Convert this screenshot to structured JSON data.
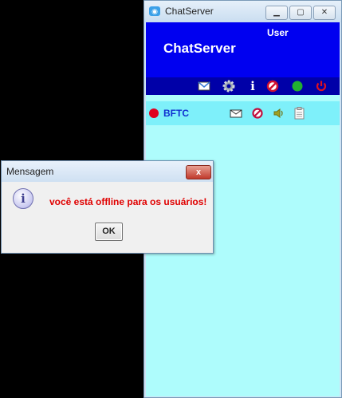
{
  "window": {
    "title": "ChatServer",
    "header": {
      "user_label": "User",
      "app_name": "ChatServer"
    },
    "toolbar": [
      "mail-icon",
      "gear-icon",
      "info-icon",
      "block-icon",
      "online-status-icon",
      "power-icon"
    ]
  },
  "users": [
    {
      "name": "BFTC",
      "status": "offline",
      "status_color": "#e00020",
      "actions": [
        "mail-icon",
        "block-icon",
        "speaker-icon",
        "clipboard-icon"
      ]
    }
  ],
  "dialog": {
    "title": "Mensagem",
    "message": "você está offline para os usuários!",
    "ok_label": "OK",
    "close_label": "x"
  },
  "colors": {
    "header_bg": "#0000f0",
    "toolbar_bg": "#0000a8",
    "client_bg": "#aefcfc",
    "row_bg": "#7ef0fa",
    "message_color": "#e00000"
  }
}
